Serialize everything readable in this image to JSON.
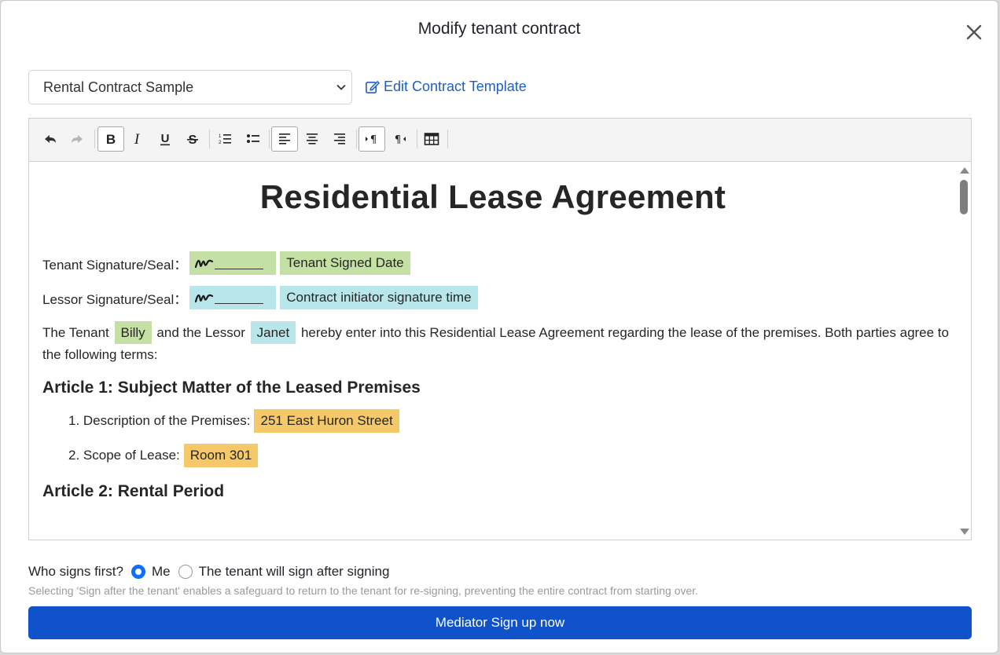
{
  "modal": {
    "title": "Modify tenant contract",
    "close_icon": "close-icon"
  },
  "template": {
    "selected": "Rental Contract Sample",
    "edit_link": "Edit Contract Template"
  },
  "toolbar": {
    "buttons": [
      "undo",
      "redo",
      "bold",
      "italic",
      "underline",
      "strikethrough",
      "ordered-list",
      "bullet-list",
      "align-left",
      "align-center",
      "align-right",
      "ltr",
      "rtl",
      "table"
    ],
    "active": [
      "bold",
      "align-left",
      "ltr"
    ]
  },
  "document": {
    "title": "Residential Lease Agreement",
    "tenant_sig_label": "Tenant Signature/Seal：",
    "tenant_signed_date": "Tenant Signed Date",
    "lessor_sig_label": "Lessor Signature/Seal：",
    "initiator_sig_time": "Contract initiator signature time",
    "intro_1": "The Tenant",
    "tenant_name": "Billy",
    "intro_2": "and the Lessor",
    "lessor_name": "Janet",
    "intro_3": "hereby enter into this Residential Lease Agreement regarding the lease of the premises. Both parties agree to the following terms:",
    "article1_title": "Article 1: Subject Matter of the Leased Premises",
    "item1_label": "1. Description of the Premises:",
    "item1_value": "251 East Huron Street",
    "item2_label": "2. Scope of Lease:",
    "item2_value": "Room 301",
    "article2_title": "Article 2: Rental Period"
  },
  "signing": {
    "question": "Who signs first?",
    "option_me": "Me",
    "option_tenant": "The tenant will sign after signing",
    "selected": "Me",
    "hint": "Selecting 'Sign after the tenant' enables a safeguard to return to the tenant for re-signing, preventing the entire contract from starting over."
  },
  "primary_button": "Mediator Sign up now",
  "colors": {
    "primary": "#0f52c9",
    "link": "#1f5fbf",
    "chip_green": "#c5e0a5",
    "chip_cyan": "#b8e6ea",
    "chip_orange": "#f5c96a"
  }
}
